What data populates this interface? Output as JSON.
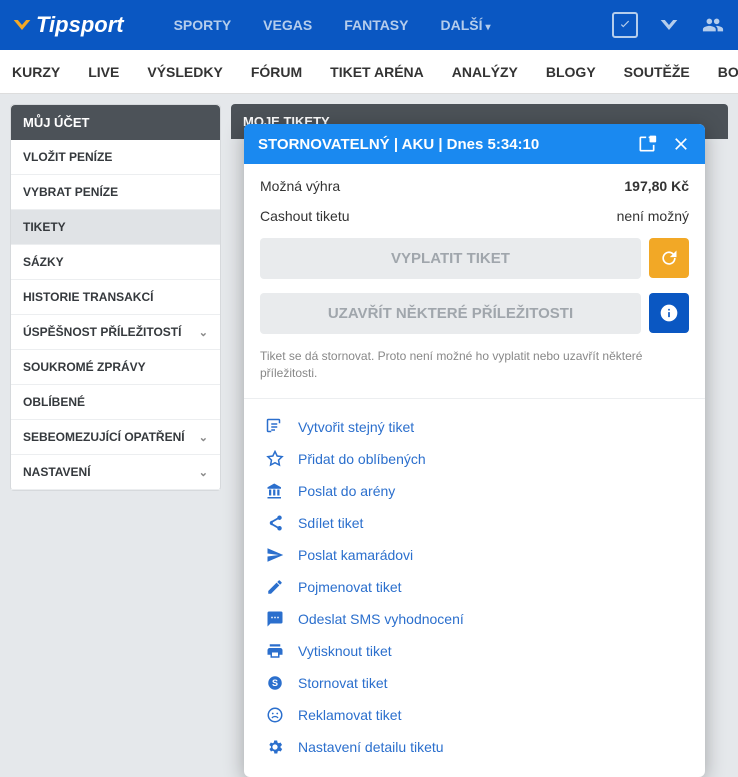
{
  "header": {
    "logo_text": "Tipsport",
    "nav": [
      "SPORTY",
      "VEGAS",
      "FANTASY",
      "DALŠÍ"
    ]
  },
  "subnav": [
    "KURZY",
    "LIVE",
    "VÝSLEDKY",
    "FÓRUM",
    "TIKET ARÉNA",
    "ANALÝZY",
    "BLOGY",
    "SOUTĚŽE",
    "BON"
  ],
  "sidebar": {
    "title": "MŮJ ÚČET",
    "items": [
      {
        "label": "VLOŽIT PENÍZE",
        "chevron": false,
        "active": false
      },
      {
        "label": "VYBRAT PENÍZE",
        "chevron": false,
        "active": false
      },
      {
        "label": "TIKETY",
        "chevron": false,
        "active": true
      },
      {
        "label": "SÁZKY",
        "chevron": false,
        "active": false
      },
      {
        "label": "HISTORIE TRANSAKCÍ",
        "chevron": false,
        "active": false
      },
      {
        "label": "ÚSPĚŠNOST PŘÍLEŽITOSTÍ",
        "chevron": true,
        "active": false
      },
      {
        "label": "SOUKROMÉ ZPRÁVY",
        "chevron": false,
        "active": false
      },
      {
        "label": "OBLÍBENÉ",
        "chevron": false,
        "active": false
      },
      {
        "label": "SEBEOMEZUJÍCÍ OPATŘENÍ",
        "chevron": true,
        "active": false
      },
      {
        "label": "NASTAVENÍ",
        "chevron": true,
        "active": false
      }
    ]
  },
  "content": {
    "title": "MOJE TIKETY"
  },
  "modal": {
    "title": "STORNOVATELNÝ | AKU | Dnes 5:34:10",
    "possible_win_label": "Možná výhra",
    "possible_win_value": "197,80 Kč",
    "cashout_label": "Cashout tiketu",
    "cashout_value": "není možný",
    "payout_btn": "VYPLATIT TIKET",
    "close_opps_btn": "UZAVŘÍT NĚKTERÉ PŘÍLEŽITOSTI",
    "note": "Tiket se dá stornovat. Proto není možné ho vyplatit nebo uzavřít některé příležitosti.",
    "actions": [
      {
        "icon": "create",
        "label": "Vytvořit stejný tiket"
      },
      {
        "icon": "star",
        "label": "Přidat do oblíbených"
      },
      {
        "icon": "arena",
        "label": "Poslat do arény"
      },
      {
        "icon": "share",
        "label": "Sdílet tiket"
      },
      {
        "icon": "send",
        "label": "Poslat kamarádovi"
      },
      {
        "icon": "edit",
        "label": "Pojmenovat tiket"
      },
      {
        "icon": "sms",
        "label": "Odeslat SMS vyhodnocení"
      },
      {
        "icon": "print",
        "label": "Vytisknout tiket"
      },
      {
        "icon": "cancel",
        "label": "Stornovat tiket"
      },
      {
        "icon": "report",
        "label": "Reklamovat tiket"
      },
      {
        "icon": "settings",
        "label": "Nastavení detailu tiketu"
      }
    ]
  }
}
